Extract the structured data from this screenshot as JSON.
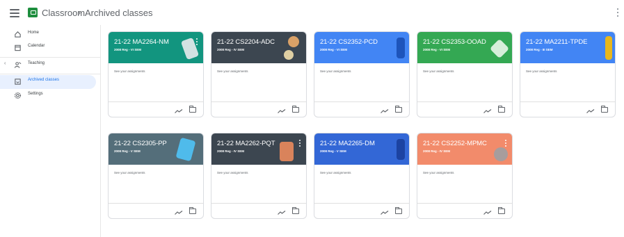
{
  "header": {
    "breadcrumb_root": "Classroom",
    "breadcrumb_separator": "›",
    "breadcrumb_current": "Archived classes"
  },
  "sidebar": {
    "items": [
      {
        "label": "Home",
        "icon": "home-icon"
      },
      {
        "label": "Calendar",
        "icon": "calendar-icon"
      },
      {
        "label": "Teaching",
        "icon": "teaching-icon"
      },
      {
        "label": "Archived classes",
        "icon": "archive-icon"
      },
      {
        "label": "Settings",
        "icon": "gear-icon"
      }
    ]
  },
  "cards": [
    {
      "title": "21-22 MA2264-NM",
      "subtitle": "2008 Reg - VI SEM",
      "color": "#12957f",
      "body": "See your assignments"
    },
    {
      "title": "21-22 CS2204-ADC",
      "subtitle": "2008 Reg - IV SEM",
      "color": "#3c4650",
      "body": "See your assignments"
    },
    {
      "title": "21-22 CS2352-PCD",
      "subtitle": "2008 Reg - VI SEM",
      "color": "#4285f4",
      "body": "See your assignments"
    },
    {
      "title": "21-22 CS2353-OOAD",
      "subtitle": "2008 Reg - VI SEM",
      "color": "#34a853",
      "body": "See your assignments"
    },
    {
      "title": "21-22 MA2211-TPDE",
      "subtitle": "2008 Reg - III SEM",
      "color": "#4285f4",
      "body": "See your assignments"
    },
    {
      "title": "21-22 CS2305-PP",
      "subtitle": "2008 Reg - V SEM",
      "color": "#546e7a",
      "body": "See your assignments"
    },
    {
      "title": "21-22 MA2262-PQT",
      "subtitle": "2008 Reg - IV SEM",
      "color": "#3c4650",
      "body": "See your assignments"
    },
    {
      "title": "21-22 MA2265-DM",
      "subtitle": "2008 Reg - V SEM",
      "color": "#3367d6",
      "body": "See your assignments"
    },
    {
      "title": "21-22 CS2252-MPMC",
      "subtitle": "2008 Reg - IV SEM",
      "color": "#f28b6b",
      "body": "See your assignments"
    }
  ]
}
